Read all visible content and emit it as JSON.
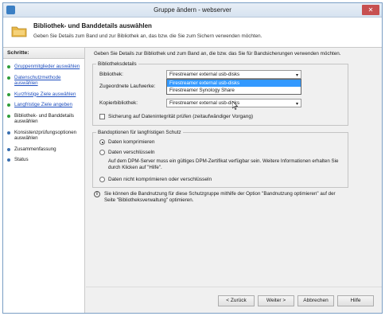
{
  "window": {
    "title": "Gruppe ändern - webserver",
    "close_glyph": "✕"
  },
  "header": {
    "title": "Bibliothek- und Banddetails auswählen",
    "subtitle": "Geben Sie Details zum Band und zur Bibliothek an, das bzw. die Sie zum Sichern verwenden möchten.",
    "icon": "folder-icon"
  },
  "sidebar": {
    "heading": "Schritte:",
    "items": [
      {
        "label": "Gruppenmitglieder auswählen",
        "state": "link"
      },
      {
        "label": "Datenschutzmethode auswählen",
        "state": "link"
      },
      {
        "label": "Kurzfristige Ziele auswählen",
        "state": "link"
      },
      {
        "label": "Langfristige Ziele angeben",
        "state": "link"
      },
      {
        "label": "Bibliothek- und Banddetails auswählen",
        "state": "current"
      },
      {
        "label": "Konsistenzprüfungsoptionen auswählen",
        "state": "todo"
      },
      {
        "label": "Zusammenfassung",
        "state": "todo"
      },
      {
        "label": "Status",
        "state": "todo"
      }
    ]
  },
  "main": {
    "intro": "Geben Sie Details zur Bibliothek und zum Band an, die bzw. das Sie für Bandsicherungen verwenden möchten.",
    "library_group": {
      "legend": "Bibliotheksdetails",
      "library_label": "Bibliothek:",
      "library_value": "Firestreamer external usb-disks",
      "drives_label": "Zugeordnete Laufwerke:",
      "copy_label": "Kopierbibliothek:",
      "copy_value": "Firestreamer external usb-disks",
      "integrity_label": "Sicherung auf Datenintegrität prüfen (zeitaufwändiger Vorgang)",
      "dropdown_options": [
        "Firestreamer external usb-disks",
        "Firestreamer Synology Share"
      ],
      "dropdown_selected_index": 0
    },
    "tape_group": {
      "legend": "Bandoptionen für langfristigen Schutz",
      "opt_compress": "Daten komprimieren",
      "opt_encrypt": "Daten verschlüsseln",
      "encrypt_note": "Auf dem DPM-Server muss ein gültiges DPM-Zertifikat verfügbar sein. Weitere Informationen erhalten Sie durch Klicken auf \"Hilfe\".",
      "opt_none": "Daten nicht komprimieren oder verschlüsseln",
      "selected": "compress"
    },
    "info_text": "Sie können die Bandnutzung für diese Schutzgruppe mithilfe der Option \"Bandnutzung optimieren\" auf der Seite \"Bibliotheksverwaltung\" optimieren.",
    "info_glyph": "i"
  },
  "buttons": {
    "back": "< Zurück",
    "next": "Weiter >",
    "cancel": "Abbrechen",
    "help": "Hilfe"
  },
  "colors": {
    "link": "#1f4fbf",
    "done_dot": "#2f9d3a",
    "selection": "#3399ff"
  }
}
